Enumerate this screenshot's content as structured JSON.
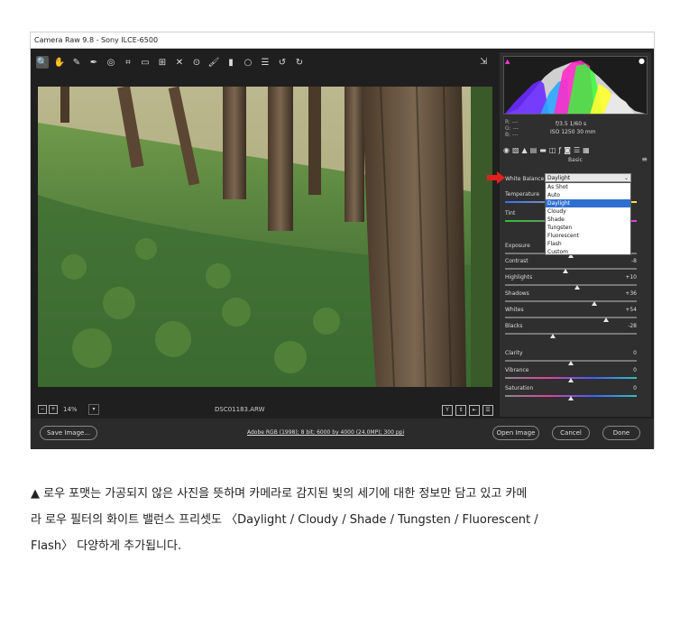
{
  "window": {
    "title": "Camera Raw 9.8 -  Sony ILCE-6500"
  },
  "toolbar": {
    "tools": [
      {
        "icon": "zoom-icon",
        "glyph": "🔍"
      },
      {
        "icon": "hand-icon",
        "glyph": "✋"
      },
      {
        "icon": "white-balance-icon",
        "glyph": "✎"
      },
      {
        "icon": "color-sampler-icon",
        "glyph": "✒"
      },
      {
        "icon": "target-adjust-icon",
        "glyph": "◎"
      },
      {
        "icon": "crop-icon",
        "glyph": "⌗"
      },
      {
        "icon": "straighten-icon",
        "glyph": "▭"
      },
      {
        "icon": "transform-icon",
        "glyph": "⊞"
      },
      {
        "icon": "spot-removal-icon",
        "glyph": "✕"
      },
      {
        "icon": "red-eye-icon",
        "glyph": "⊙"
      },
      {
        "icon": "brush-icon",
        "glyph": "🖌"
      },
      {
        "icon": "graduated-filter-icon",
        "glyph": "▮"
      },
      {
        "icon": "radial-filter-icon",
        "glyph": "○"
      },
      {
        "icon": "preferences-icon",
        "glyph": "☰"
      },
      {
        "icon": "rotate-left-icon",
        "glyph": "↺"
      },
      {
        "icon": "rotate-right-icon",
        "glyph": "↻"
      }
    ]
  },
  "statusbar": {
    "zoom": "14%",
    "filename": "DSC01183.ARW"
  },
  "bottombar": {
    "save_label": "Save Image...",
    "workflow": "Adobe RGB (1998); 8 bit; 6000 by 4000 (24.0MP); 300 ppi",
    "open_label": "Open Image",
    "cancel_label": "Cancel",
    "done_label": "Done"
  },
  "readout": {
    "r": "R:   ---",
    "g": "G:   ---",
    "b": "B:   ---",
    "exif1": "f/3.5   1/60 s",
    "exif2": "ISO 1250   30 mm"
  },
  "panel": {
    "title": "Basic",
    "wb_label": "White Balance:",
    "wb_value": "Daylight",
    "wb_options": [
      "As Shot",
      "Auto",
      "Daylight",
      "Cloudy",
      "Shade",
      "Tungsten",
      "Fluorescent",
      "Flash",
      "Custom"
    ],
    "wb_selected": 2,
    "sliders": [
      {
        "label": "Temperature",
        "value": "",
        "pos": 0.45
      },
      {
        "label": "Tint",
        "value": "",
        "pos": 0.5
      },
      {
        "label": "Exposure",
        "value": "",
        "pos": 0.5
      },
      {
        "label": "Contrast",
        "value": "-8",
        "pos": 0.46
      },
      {
        "label": "Highlights",
        "value": "+10",
        "pos": 0.55
      },
      {
        "label": "Shadows",
        "value": "+36",
        "pos": 0.68
      },
      {
        "label": "Whites",
        "value": "+54",
        "pos": 0.77
      },
      {
        "label": "Blacks",
        "value": "-28",
        "pos": 0.36
      },
      {
        "label": "Clarity",
        "value": "0",
        "pos": 0.5
      },
      {
        "label": "Vibrance",
        "value": "0",
        "pos": 0.5
      },
      {
        "label": "Saturation",
        "value": "0",
        "pos": 0.5
      }
    ]
  },
  "caption": {
    "line1": "▲ 로우 포맷는 가공되지 않은 사진을 뜻하며 카메라로 감지된 빛의 세기에 대한 정보만 담고 있고 카메",
    "line2": "라 로우 필터의 화이트 밸런스 프리셋도 〈Daylight / Cloudy / Shade / Tungsten / Fluorescent /",
    "line3": "Flash〉 다양하게 추가됩니다."
  },
  "colors": {
    "accent_blue": "#2f6fd0",
    "arrow_red": "#e02020"
  }
}
